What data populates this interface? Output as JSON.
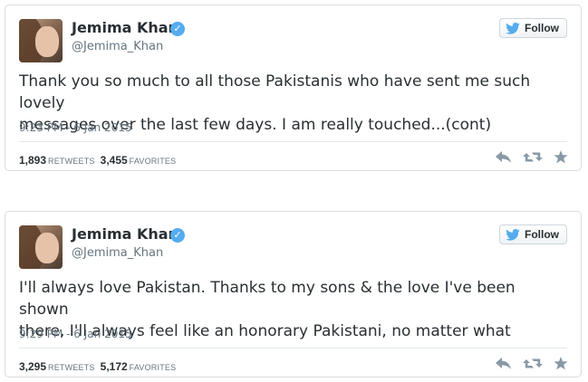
{
  "tweets": [
    {
      "name": "Jemima Khan",
      "handle": "@Jemima_Khan",
      "follow_label": "Follow",
      "text": "Thank you so much to all those Pakistanis who have sent me such lovely\nmessages over the last few days. I am really touched...(cont)",
      "time": "9:23 PM - 6 Jan 2015",
      "retweets": "1,893",
      "retweets_label": "RETWEETS",
      "favorites": "3,455",
      "favorites_label": "FAVORITES"
    },
    {
      "name": "Jemima Khan",
      "handle": "@Jemima_Khan",
      "follow_label": "Follow",
      "text": "I'll always love Pakistan. Thanks to my sons & the love I've been shown\nthere, I'll always feel like an honorary Pakistani, no matter what",
      "time": "9:29 PM - 6 Jan 2015",
      "retweets": "3,295",
      "retweets_label": "RETWEETS",
      "favorites": "5,172",
      "favorites_label": "FAVORITES"
    }
  ],
  "icons": {
    "verified": "verified-badge-icon",
    "bird": "twitter-bird-icon",
    "reply": "reply-icon",
    "retweet": "retweet-icon",
    "favorite": "star-icon"
  },
  "colors": {
    "brand": "#55acee",
    "text": "#292f33",
    "muted": "#66757f",
    "action_icon": "#8899a6"
  }
}
